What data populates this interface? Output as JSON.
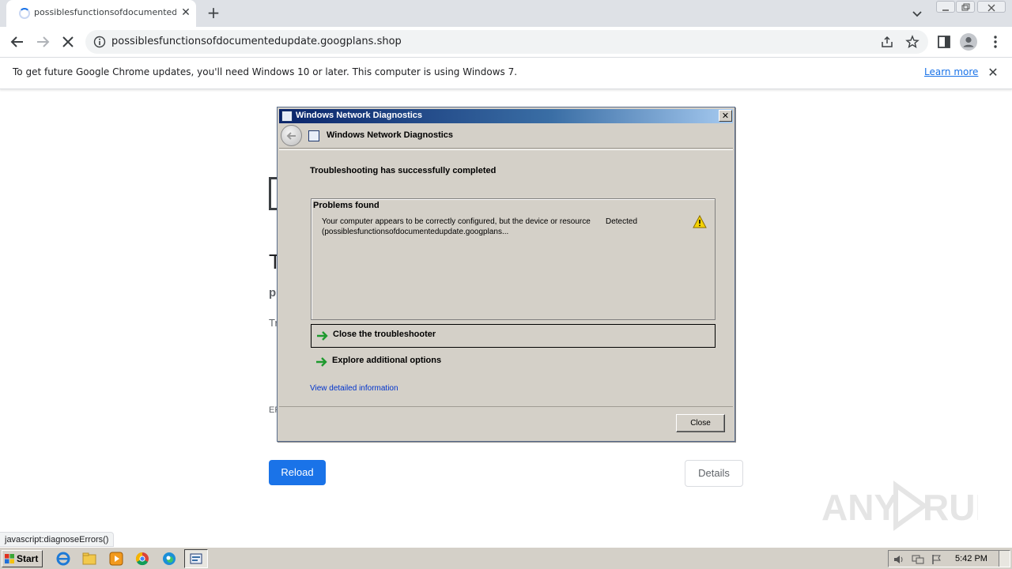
{
  "browser": {
    "tab_title": "possiblesfunctionsofdocumentedupdate.googplans.shop",
    "url": "possiblesfunctionsofdocumentedupdate.googplans.shop",
    "infobar": {
      "message": "To get future Google Chrome updates, you'll need Windows 10 or later. This computer is using Windows 7.",
      "link": "Learn more"
    },
    "status_url": "javascript:diagnoseErrors()"
  },
  "page": {
    "fragments": [
      "T",
      "p",
      "Tr",
      "EF"
    ],
    "reload_label": "Reload",
    "details_label": "Details"
  },
  "dialog": {
    "title": "Windows Network Diagnostics",
    "nav_title": "Windows Network Diagnostics",
    "heading": "Troubleshooting has successfully completed",
    "problems_header": "Problems found",
    "problem_description": "Your computer appears to be correctly configured, but the device or resource (possiblesfunctionsofdocumentedupdate.googplans...",
    "problem_status": "Detected",
    "options": [
      "Close the troubleshooter",
      "Explore additional options"
    ],
    "view_details": "View detailed information",
    "close_button": "Close"
  },
  "taskbar": {
    "start_label": "Start",
    "clock": "5:42 PM"
  },
  "watermark": "ANY RUN",
  "colors": {
    "accent": "#1a73e8",
    "titlebar_start": "#0a246a",
    "titlebar_end": "#a6caf0",
    "dialog_bg": "#d4d0c8",
    "link_blue": "#0033cc",
    "arrow_green": "#1e9a2e"
  }
}
